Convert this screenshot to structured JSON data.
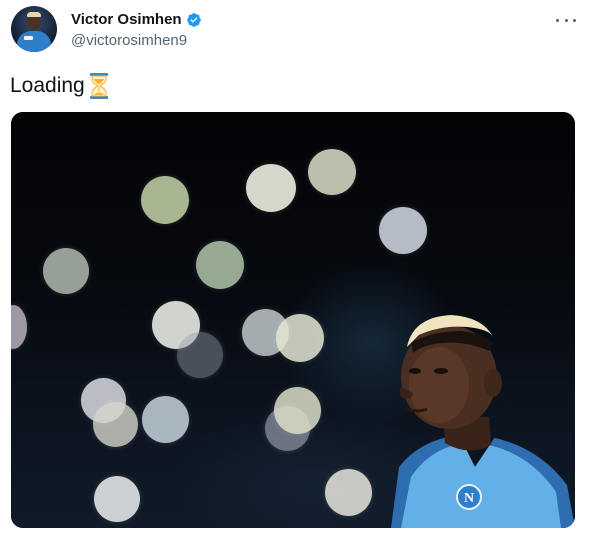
{
  "author": {
    "name": "Victor Osimhen",
    "handle": "@victorosimhen9",
    "verified": true
  },
  "tweet": {
    "text": "Loading",
    "emoji": "hourglass-icon"
  },
  "media": {
    "description_icon": "photo-image"
  },
  "colors": {
    "verified_badge": "#1d9bf0",
    "handle_text": "#536471",
    "jersey": "#5aa7e0"
  }
}
